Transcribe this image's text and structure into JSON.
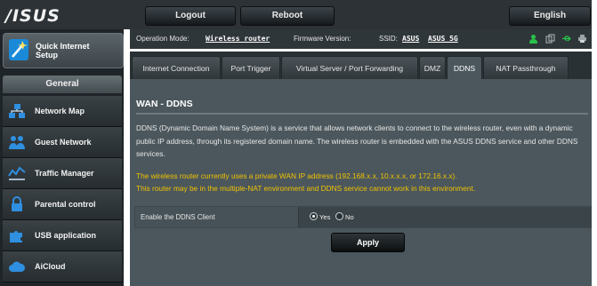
{
  "header": {
    "logo": "/ISUS",
    "logout_label": "Logout",
    "reboot_label": "Reboot",
    "language": "English"
  },
  "sidebar": {
    "quick_setup": {
      "line1": "Quick Internet",
      "line2": "Setup",
      "icon": "wand-icon"
    },
    "section_title": "General",
    "items": [
      {
        "label": "Network Map",
        "icon": "network-map-icon"
      },
      {
        "label": "Guest Network",
        "icon": "guest-network-icon"
      },
      {
        "label": "Traffic Manager",
        "icon": "traffic-manager-icon"
      },
      {
        "label": "Parental control",
        "icon": "lock-icon"
      },
      {
        "label": "USB application",
        "icon": "puzzle-icon"
      },
      {
        "label": "AiCloud",
        "icon": "cloud-icon"
      }
    ]
  },
  "status": {
    "op_mode_label": "Operation Mode:",
    "op_mode_value": "Wireless router",
    "firmware_label": "Firmware Version:",
    "ssid_label": "SSID:",
    "ssid_1": "ASUS",
    "ssid_2": "ASUS_5G",
    "icons": [
      "user-icon",
      "copy-icon",
      "usb-icon",
      "printer-icon"
    ]
  },
  "tabs": [
    {
      "label": "Internet Connection",
      "active": false
    },
    {
      "label": "Port Trigger",
      "active": false
    },
    {
      "label": "Virtual Server / Port Forwarding",
      "active": false
    },
    {
      "label": "DMZ",
      "active": false
    },
    {
      "label": "DDNS",
      "active": true
    },
    {
      "label": "NAT Passthrough",
      "active": false
    }
  ],
  "main": {
    "title": "WAN - DDNS",
    "description": "DDNS (Dynamic Domain Name System) is a service that allows network clients to connect to the wireless router, even with a dynamic public IP address, through its registered domain name. The wireless router is embedded with the ASUS DDNS service and other DDNS services.",
    "warning_1": "The wireless router currently uses a private WAN IP address (192.168.x.x, 10.x.x.x, or 172.16.x.x).",
    "warning_2": "This router may be in the multiple-NAT environment and DDNS service cannot work in this environment.",
    "enable_label": "Enable the DDNS Client",
    "yes_label": "Yes",
    "no_label": "No",
    "enable_value": "Yes",
    "apply_label": "Apply"
  },
  "colors": {
    "accent_warning": "#f2c200",
    "panel": "#4b575d",
    "topbar": "#2c3236",
    "status_icon_green": "#28c24a"
  }
}
